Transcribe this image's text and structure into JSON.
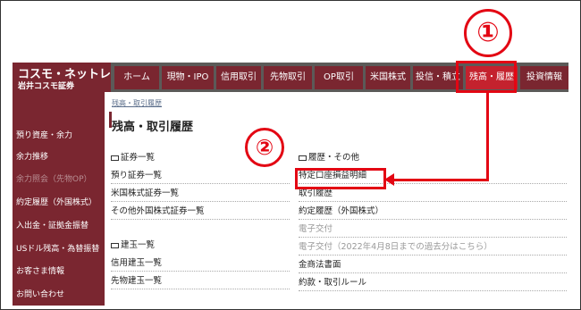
{
  "logo": {
    "line1": "コスモ・ネットレ",
    "line2": "岩井コスモ証券"
  },
  "nav": [
    {
      "label": "ホーム"
    },
    {
      "label": "現物・IPO"
    },
    {
      "label": "信用取引"
    },
    {
      "label": "先物取引"
    },
    {
      "label": "OP取引"
    },
    {
      "label": "米国株式"
    },
    {
      "label": "投信・積立"
    },
    {
      "label": "残高・履歴"
    },
    {
      "label": "投資情報"
    }
  ],
  "sidebar": [
    {
      "label": "預り資産・余力"
    },
    {
      "label": "余力推移"
    },
    {
      "label": "余力照会（先物OP）"
    },
    {
      "label": "約定履歴（外国株式）"
    },
    {
      "label": "入出金・証拠金振替"
    },
    {
      "label": "USドル残高・為替振替"
    },
    {
      "label": "お客さま情報"
    },
    {
      "label": "お問い合わせ"
    }
  ],
  "breadcrumb": "残高・取引履歴",
  "page_title": "残高・取引履歴",
  "left_col": {
    "section1": "証券一覧",
    "links1": [
      "預り証券一覧",
      "米国株式証券一覧",
      "その他外国株式証券一覧"
    ],
    "section2": "建玉一覧",
    "links2": [
      "信用建玉一覧",
      "先物建玉一覧"
    ]
  },
  "right_col": {
    "section1": "履歴・その他",
    "links": [
      "特定口座損益明細",
      "取引履歴",
      "約定履歴（外国株式）",
      "電子交付",
      "電子交付（2022年4月8日までの過去分はこちら）",
      "金商法書面",
      "約款・取引ルール"
    ]
  },
  "annotations": {
    "marker1": "①",
    "marker2": "②",
    "color": "#e30613"
  },
  "colors": {
    "brand": "#7a2630",
    "nav_bg": "#5b5a58",
    "active": "#c4222e"
  }
}
